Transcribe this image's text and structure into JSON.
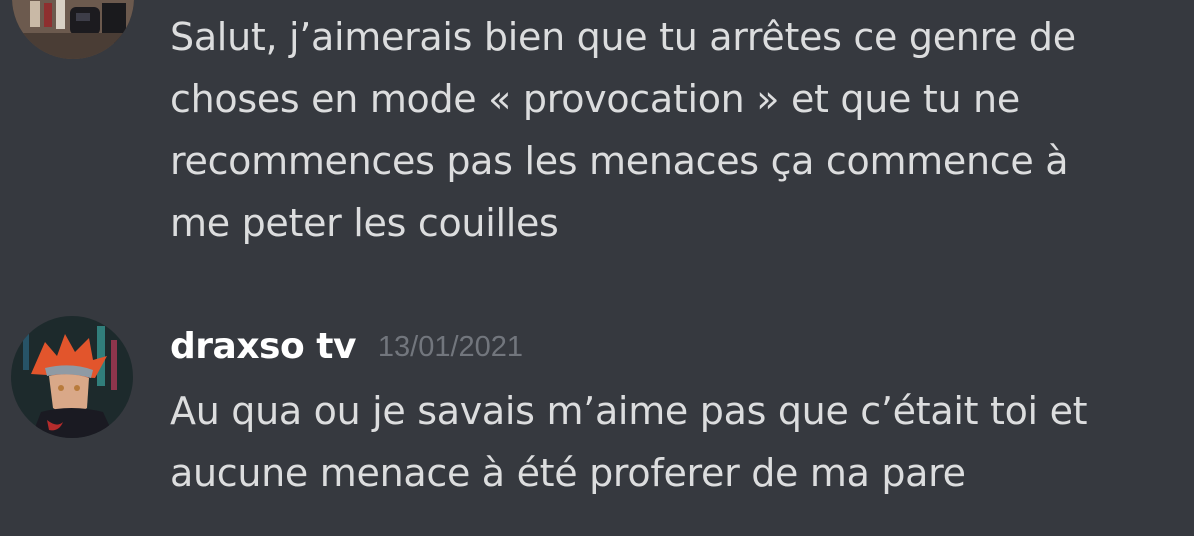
{
  "messages": [
    {
      "lines": [
        "Salut, j’aimerais bien que tu arrêtes ce genre de",
        "choses en mode « provocation » et que tu ne",
        "recommences pas les menaces ça commence à",
        "me peter les couilles"
      ]
    },
    {
      "author": "draxso tv",
      "timestamp": "13/01/2021",
      "lines": [
        "Au qua ou je savais m’aime pas que c’était toi et",
        "aucune menace à été proferer de ma pare"
      ]
    }
  ],
  "colors": {
    "background": "#36393f",
    "message_text": "#dcddde",
    "username": "#ffffff",
    "timestamp": "#72767d"
  }
}
